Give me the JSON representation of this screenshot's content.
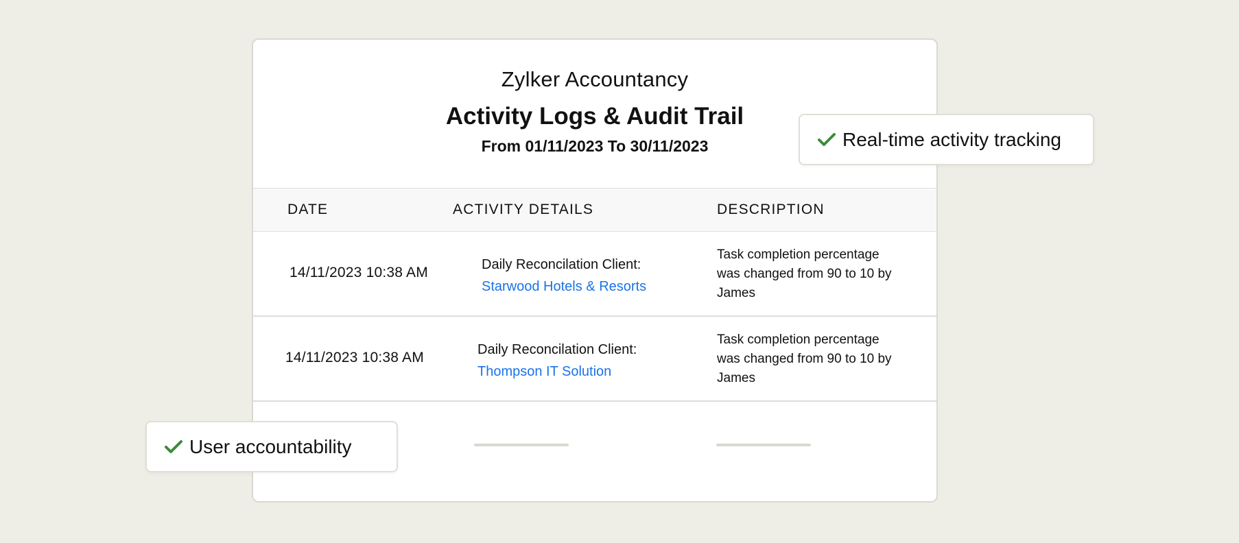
{
  "report": {
    "company": "Zylker Accountancy",
    "title": "Activity Logs & Audit Trail",
    "date_range": "From 01/11/2023 To 30/11/2023"
  },
  "table": {
    "headers": {
      "date": "DATE",
      "activity": "ACTIVITY DETAILS",
      "description": "DESCRIPTION"
    },
    "rows": [
      {
        "date": "14/11/2023 10:38 AM",
        "activity_prefix": "Daily Reconcilation Client:",
        "client": "Starwood Hotels & Resorts",
        "description": "Task completion percentage was changed from 90 to 10 by James"
      },
      {
        "date": "14/11/2023 10:38 AM",
        "activity_prefix": "Daily Reconcilation Client:",
        "client": "Thompson IT Solution",
        "description": "Task completion percentage was changed from 90 to 10 by James"
      }
    ]
  },
  "features": [
    {
      "label": "Real-time activity tracking",
      "icon": "check-icon"
    },
    {
      "label": "User accountability",
      "icon": "check-icon"
    }
  ],
  "colors": {
    "background": "#eeeee6",
    "link": "#1a73e8",
    "check": "#3c8c3c"
  }
}
